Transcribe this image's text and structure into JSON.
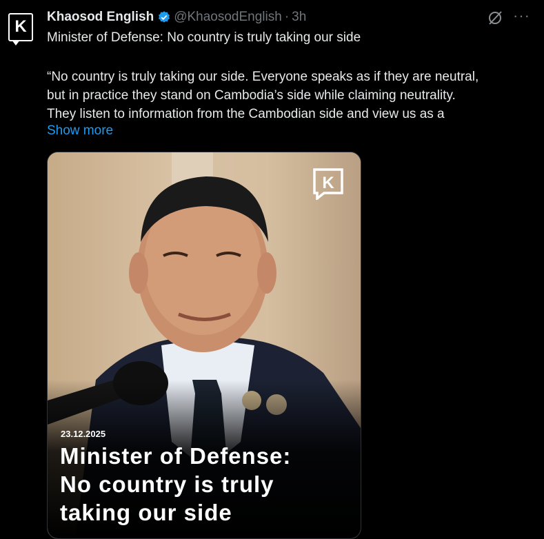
{
  "account": {
    "avatar_letter": "K",
    "name": "Khaosod English",
    "handle": "@KhaosodEnglish",
    "separator": "·",
    "time": "3h"
  },
  "icons": {
    "verified": "verified-badge-icon",
    "grok": "grok-icon",
    "more": "more-icon"
  },
  "more_label": "···",
  "tweet": {
    "title": "Minister of Defense: No country is truly taking our side",
    "quote_lines": [
      "“No country is truly taking our side. Everyone speaks as if they are neutral,",
      "but in practice they stand on Cambodia’s side while claiming neutrality.",
      "They listen to information from the Cambodian side and view us as a"
    ],
    "show_more": "Show more"
  },
  "media": {
    "logo_letter": "K",
    "date": "23.12.2025",
    "headline_lines": [
      "Minister of Defense:",
      "No country is truly",
      "taking our side"
    ]
  },
  "colors": {
    "background": "#000000",
    "text": "#e7e9ea",
    "muted": "#71767b",
    "link": "#1d9bf0"
  }
}
